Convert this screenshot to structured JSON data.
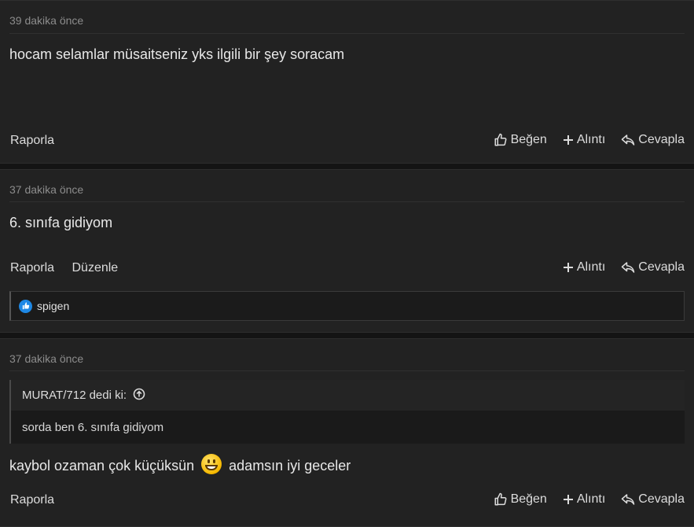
{
  "posts": [
    {
      "time": "39 dakika önce",
      "text": "hocam selamlar müsaitseniz yks ilgili bir şey soracam",
      "report": "Raporla",
      "like": "Beğen",
      "quote": "Alıntı",
      "reply": "Cevapla"
    },
    {
      "time": "37 dakika önce",
      "text": "6. sınıfa gidiyom",
      "report": "Raporla",
      "edit": "Düzenle",
      "quote": "Alıntı",
      "reply": "Cevapla",
      "reaction_user": "spigen"
    },
    {
      "time": "37 dakika önce",
      "quote_author": "MURAT/712 dedi ki:",
      "quote_text": "sorda ben 6. sınıfa gidiyom",
      "text_before": "kaybol ozaman çok küçüksün",
      "text_after": "adamsın iyi geceler",
      "emoji": "grinning-face",
      "report": "Raporla",
      "like": "Beğen",
      "quote": "Alıntı",
      "reply": "Cevapla"
    }
  ],
  "colors": {
    "background": "#141414",
    "post_bg": "#222222",
    "like_blue": "#1e88e5"
  }
}
